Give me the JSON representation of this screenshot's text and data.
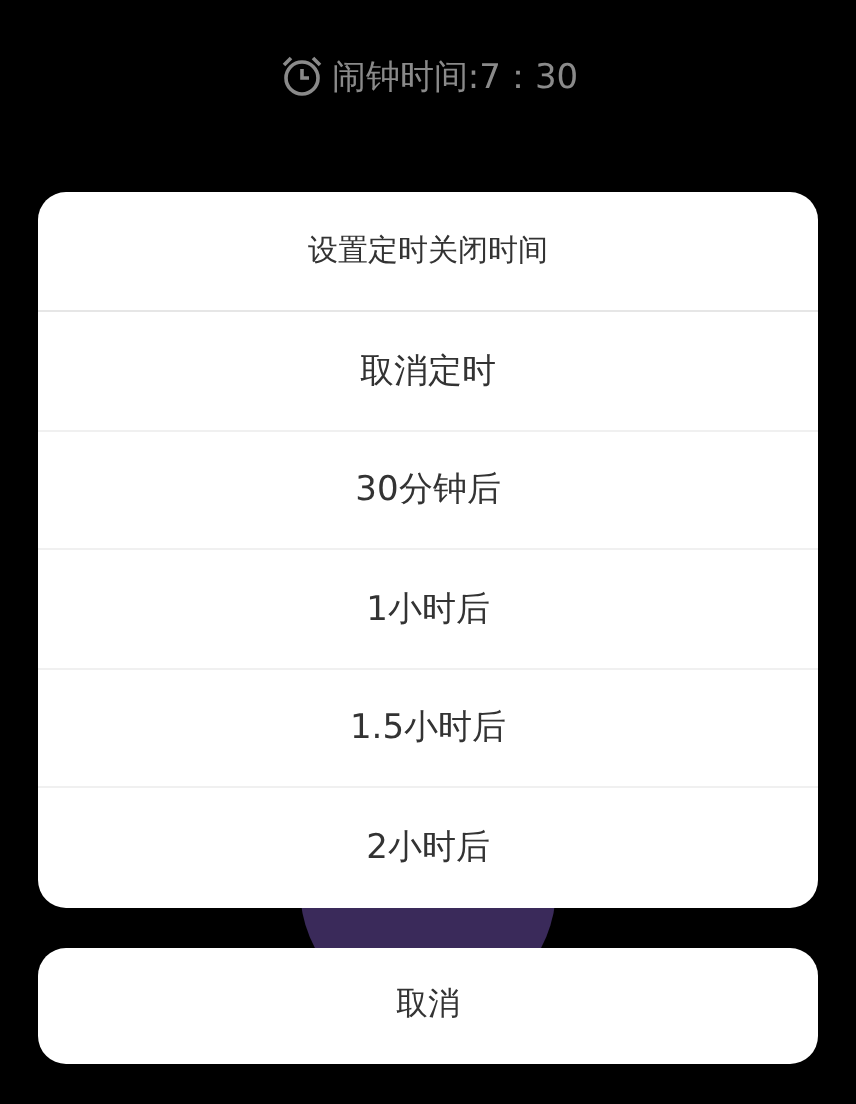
{
  "alarm": {
    "label": "闹钟时间:7：30"
  },
  "dialog": {
    "title": "设置定时关闭时间",
    "options": [
      {
        "label": "取消定时"
      },
      {
        "label": "30分钟后"
      },
      {
        "label": "1小时后"
      },
      {
        "label": "1.5小时后"
      },
      {
        "label": "2小时后"
      }
    ]
  },
  "cancel_button": {
    "label": "取消"
  }
}
